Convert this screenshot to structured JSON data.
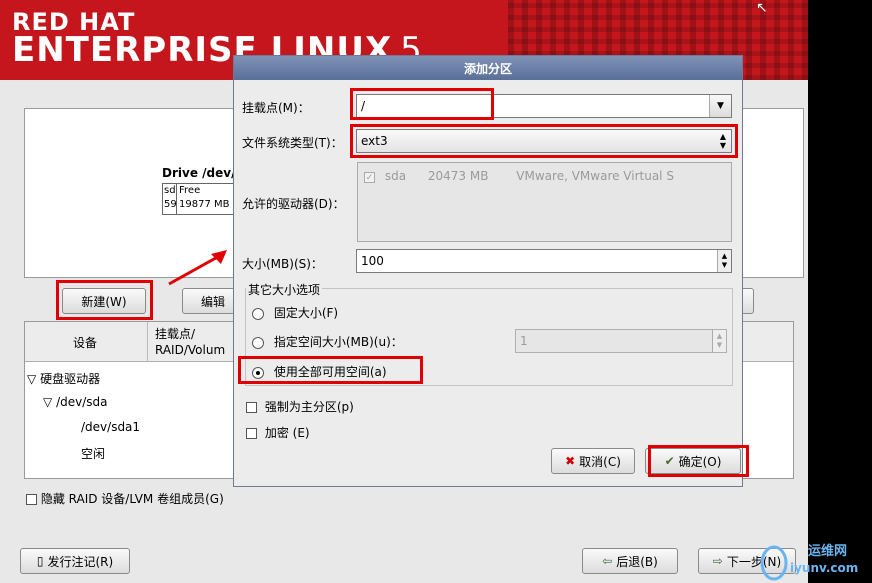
{
  "header": {
    "brand_line1": "RED HAT",
    "brand_line2": "ENTERPRISE LINUX",
    "brand_version": "5"
  },
  "drive_summary": {
    "title": "Drive /dev/",
    "seg1_top": "sd",
    "seg1_bottom": "59",
    "seg2_top": "Free",
    "seg2_bottom": "19877 MB"
  },
  "buttons": {
    "new": "新建(W)",
    "edit": "编辑",
    "release_notes": "发行注记(R)",
    "back": "后退(B)",
    "next": "下一步(N)"
  },
  "tree": {
    "col_device": "设备",
    "col_mount_line1": "挂载点/",
    "col_mount_line2": "RAID/Volum",
    "rows": [
      "硬盘驱动器",
      "/dev/sda",
      "/dev/sda1",
      "空闲"
    ]
  },
  "hide_raid_label": "隐藏 RAID 设备/LVM 卷组成员(G)",
  "dialog": {
    "title": "添加分区",
    "mount_label": "挂载点(M)：",
    "mount_value": "/",
    "fstype_label": "文件系统类型(T)：",
    "fstype_value": "ext3",
    "allowed_drives_label": "允许的驱动器(D)：",
    "drive_entry": {
      "checked": true,
      "name": "sda",
      "size": "20473 MB",
      "model": "VMware, VMware Virtual S"
    },
    "size_label": "大小(MB)(S)：",
    "size_value": "100",
    "other_size_legend": "其它大小选项",
    "opt_fixed": "固定大小(F)",
    "opt_upto": "指定空间大小(MB)(u)：",
    "opt_upto_value": "1",
    "opt_fill": "使用全部可用空间(a)",
    "selected_option": "fill",
    "force_primary": "强制为主分区(p)",
    "encrypt": "加密 (E)",
    "cancel": "取消(C)",
    "ok": "确定(O)"
  },
  "watermark": {
    "line1": "运维网",
    "line2": "iyunv.com"
  },
  "colors": {
    "banner": "#c4161c",
    "dialog_title": "#5a6f97",
    "annotation": "#e00000"
  }
}
